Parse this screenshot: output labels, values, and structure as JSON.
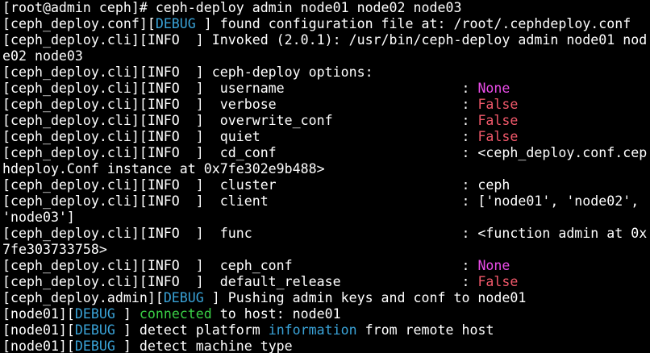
{
  "terminal": {
    "lines": [
      [
        {
          "t": "[root@admin ceph]# ceph-deploy admin node01 node02 node03"
        }
      ],
      [
        {
          "t": "[ceph_deploy.conf]["
        },
        {
          "t": "DEBUG",
          "c": "cyan"
        },
        {
          "t": " ] found configuration file at: /root/.cephdeploy.conf"
        }
      ],
      [
        {
          "t": "[ceph_deploy.cli][INFO  ] Invoked (2.0.1): /usr/bin/ceph-deploy admin node01 nod"
        }
      ],
      [
        {
          "t": "e02 node03"
        }
      ],
      [
        {
          "t": "[ceph_deploy.cli][INFO  ] ceph-deploy options:"
        }
      ],
      [
        {
          "t": "[ceph_deploy.cli][INFO  ]  username                      : "
        },
        {
          "t": "None",
          "c": "magenta"
        }
      ],
      [
        {
          "t": "[ceph_deploy.cli][INFO  ]  verbose                       : "
        },
        {
          "t": "False",
          "c": "red"
        }
      ],
      [
        {
          "t": "[ceph_deploy.cli][INFO  ]  overwrite_conf                : "
        },
        {
          "t": "False",
          "c": "red"
        }
      ],
      [
        {
          "t": "[ceph_deploy.cli][INFO  ]  quiet                         : "
        },
        {
          "t": "False",
          "c": "red"
        }
      ],
      [
        {
          "t": "[ceph_deploy.cli][INFO  ]  cd_conf                       : <ceph_deploy.conf.cep"
        }
      ],
      [
        {
          "t": "hdeploy.Conf instance at 0x7fe302e9b488>"
        }
      ],
      [
        {
          "t": "[ceph_deploy.cli][INFO  ]  cluster                       : ceph"
        }
      ],
      [
        {
          "t": "[ceph_deploy.cli][INFO  ]  client                        : ['node01', 'node02',"
        }
      ],
      [
        {
          "t": "'node03']"
        }
      ],
      [
        {
          "t": "[ceph_deploy.cli][INFO  ]  func                          : <function admin at 0x"
        }
      ],
      [
        {
          "t": "7fe303733758>"
        }
      ],
      [
        {
          "t": "[ceph_deploy.cli][INFO  ]  ceph_conf                     : "
        },
        {
          "t": "None",
          "c": "magenta"
        }
      ],
      [
        {
          "t": "[ceph_deploy.cli][INFO  ]  default_release               : "
        },
        {
          "t": "False",
          "c": "red"
        }
      ],
      [
        {
          "t": "[ceph_deploy.admin]["
        },
        {
          "t": "DEBUG",
          "c": "cyan"
        },
        {
          "t": " ] Pushing admin keys and conf to node01"
        }
      ],
      [
        {
          "t": "[node01]["
        },
        {
          "t": "DEBUG",
          "c": "cyan"
        },
        {
          "t": " ] "
        },
        {
          "t": "connected",
          "c": "green"
        },
        {
          "t": " to host: node01"
        }
      ],
      [
        {
          "t": "[node01]["
        },
        {
          "t": "DEBUG",
          "c": "cyan"
        },
        {
          "t": " ] detect platform "
        },
        {
          "t": "information",
          "c": "cyan"
        },
        {
          "t": " from remote host"
        }
      ],
      [
        {
          "t": "[node01]["
        },
        {
          "t": "DEBUG",
          "c": "cyan"
        },
        {
          "t": " ] detect machine type"
        }
      ]
    ]
  },
  "colors": {
    "background": "#000000",
    "text": "#ffffff",
    "debug": "#3aa3d8",
    "connected": "#3ad046",
    "none": "#e94ce7",
    "false": "#f0586a"
  }
}
